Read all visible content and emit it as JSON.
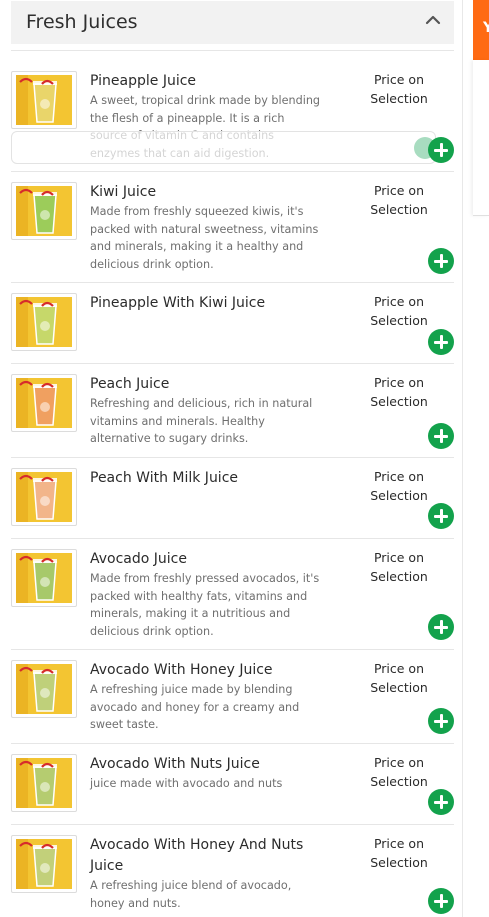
{
  "section": {
    "title": "Fresh Juices"
  },
  "items": [
    {
      "name": "Pineapple Juice",
      "description": "A sweet, tropical drink made by blending the flesh of a pineapple. It is a rich source of vitamin C and contains enzymes that can aid digestion.",
      "price": "Price on Selection"
    },
    {
      "name": "Kiwi Juice",
      "description": "Made from freshly squeezed kiwis, it's packed with natural sweetness, vitamins and minerals, making it a healthy and delicious drink option.",
      "price": "Price on Selection"
    },
    {
      "name": "Pineapple With Kiwi Juice",
      "description": "",
      "price": "Price on Selection"
    },
    {
      "name": "Peach Juice",
      "description": "Refreshing and delicious, rich in natural vitamins and minerals. Healthy alternative to sugary drinks.",
      "price": "Price on Selection"
    },
    {
      "name": "Peach With Milk Juice",
      "description": "",
      "price": "Price on Selection"
    },
    {
      "name": "Avocado Juice",
      "description": "Made from freshly pressed avocados, it's packed with healthy fats, vitamins and minerals, making it a nutritious and delicious drink option.",
      "price": "Price on Selection"
    },
    {
      "name": "Avocado With Honey Juice",
      "description": "A refreshing juice made by blending avocado and honey for a creamy and sweet taste.",
      "price": "Price on Selection"
    },
    {
      "name": "Avocado With Nuts Juice",
      "description": "juice made with avocado and nuts",
      "price": "Price on Selection"
    },
    {
      "name": "Avocado With Honey And Nuts Juice",
      "description": "A refreshing juice blend of avocado, honey and nuts.",
      "price": "Price on Selection"
    }
  ],
  "side_tab": {
    "letter": "Y"
  },
  "colors": {
    "add_button": "#13a24c",
    "header_bg": "#f2f2f2",
    "side_accent": "#ff6a13"
  },
  "icons": {
    "collapse": "chevron-up-icon",
    "add": "plus-circle-icon"
  }
}
